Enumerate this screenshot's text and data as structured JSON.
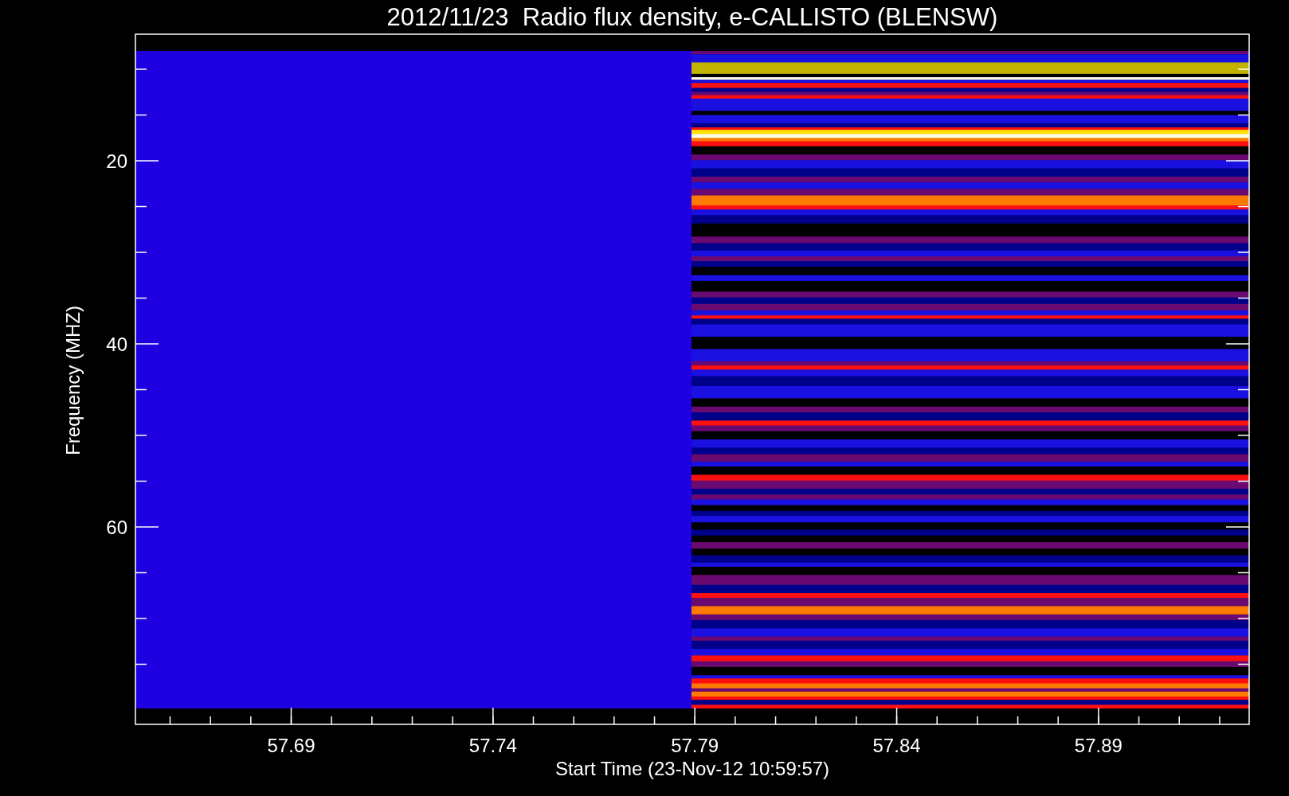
{
  "title": "2012/11/23  Radio flux density, e-CALLISTO (BLENSW)",
  "y_axis": {
    "label": "Frequency (MHZ)",
    "tick_labels": [
      "20",
      "40",
      "60"
    ]
  },
  "x_axis": {
    "label": "Start Time (23-Nov-12 10:59:57)",
    "tick_labels": [
      "57.69",
      "57.74",
      "57.79",
      "57.84",
      "57.89"
    ]
  }
}
